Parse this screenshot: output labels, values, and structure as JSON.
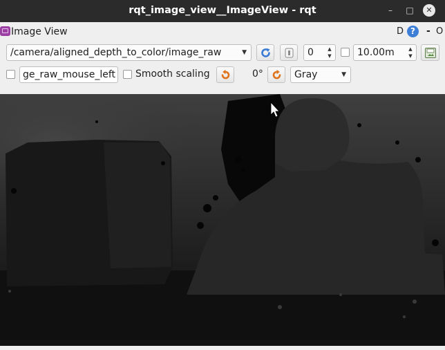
{
  "window": {
    "title": "rqt_image_view__ImageView - rqt",
    "controls": {
      "minimize": "–",
      "maximize": "□",
      "close": "✕"
    }
  },
  "dock": {
    "title": "Image View",
    "d_label": "D",
    "help_label": "?",
    "min_label": "-",
    "o_label": "O"
  },
  "toolbar": {
    "topic": "/camera/aligned_depth_to_color/image_raw",
    "refresh_icon": "refresh-icon",
    "zoom_icon": "zoom-1-icon",
    "spin_value": "0",
    "max_range": "10.00m",
    "save_icon": "save-image-icon",
    "mouse_topic": "ge_raw_mouse_left",
    "smooth_label": "Smooth scaling",
    "rotate_left_icon": "rotate-left-icon",
    "rotation": "0°",
    "rotate_right_icon": "rotate-right-icon",
    "colormap": "Gray"
  },
  "colors": {
    "titlebar_bg": "#2b2b2b",
    "window_bg": "#efefef",
    "refresh_blue": "#3a7bd5",
    "rotate_orange": "#e0741c",
    "image_bg": "#0c0c0c"
  }
}
